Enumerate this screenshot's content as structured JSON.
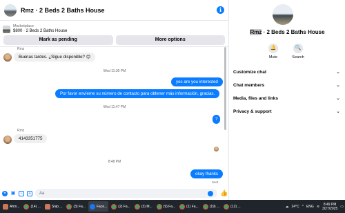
{
  "chat": {
    "title": "Rmz · 2 Beds 2 Baths House",
    "info_icon": "info-icon",
    "listing": {
      "label": "Marketplace",
      "price_title": "$800 · 2 Beds 2 Baths House"
    },
    "buttons": {
      "mark_pending": "Mark as pending",
      "more_options": "More options"
    },
    "top_sender": "Rmz",
    "messages": [
      {
        "id": "m1",
        "text": "Buenas tardes. ¿Sigue disponible? 😊",
        "dir": "in"
      },
      {
        "id": "t1",
        "text": "Wed 11:30 PM",
        "dir": "time"
      },
      {
        "id": "m2",
        "text": "yes are you interested",
        "dir": "out"
      },
      {
        "id": "m3",
        "text": "Por favor envíeme su número de contacto para obtener más información, gracias.",
        "dir": "out"
      },
      {
        "id": "t2",
        "text": "Wed 11:47 PM",
        "dir": "time"
      },
      {
        "id": "m4",
        "text": "?",
        "dir": "out"
      },
      {
        "id": "s1",
        "text": "Rmz",
        "dir": "sender"
      },
      {
        "id": "m5",
        "text": "4143351775",
        "dir": "in"
      },
      {
        "id": "t3",
        "text": "8:48 PM",
        "dir": "time"
      },
      {
        "id": "m6",
        "text": "okay thanks",
        "dir": "out"
      }
    ],
    "sent_label": "Sent",
    "composer_placeholder": "Aa"
  },
  "side": {
    "name_highlight": "Rmz",
    "name_rest": " · 2 Beds 2 Baths House",
    "mute_label": "Mute",
    "search_label": "Search",
    "sections": [
      "Customize chat",
      "Chat members",
      "Media, files and links",
      "Privacy & support"
    ]
  },
  "taskbar": {
    "items": [
      "Ahm...",
      "(14) ...",
      "Snip ...",
      "(3) Fa...",
      "Face...",
      "(2) Fa...",
      "(3) M...",
      "(9) Fa...",
      "(1) Fa...",
      "(19) ...",
      "(12) ..."
    ],
    "weather": "24°C",
    "lang": "ENG",
    "time": "8:49 PM",
    "date": "3/27/2025"
  },
  "colors": {
    "accent": "#0a7cff",
    "bubble_in": "#f0f0f0",
    "taskbar": "#20242b"
  }
}
